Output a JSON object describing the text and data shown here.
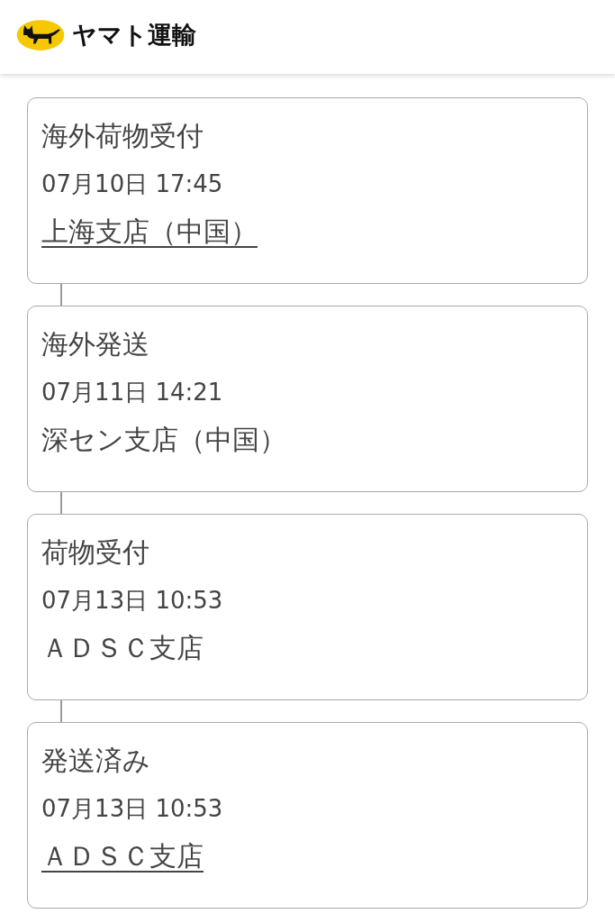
{
  "header": {
    "brand": "ヤマト運輸"
  },
  "events": [
    {
      "status": "海外荷物受付",
      "datetime": "07月10日 17:45",
      "location": "上海支店（中国）",
      "linked": true
    },
    {
      "status": "海外発送",
      "datetime": "07月11日 14:21",
      "location": "深セン支店（中国）",
      "linked": false
    },
    {
      "status": "荷物受付",
      "datetime": "07月13日 10:53",
      "location": "ＡＤＳＣ支店",
      "linked": false
    },
    {
      "status": "発送済み",
      "datetime": "07月13日 10:53",
      "location": "ＡＤＳＣ支店",
      "linked": true
    }
  ]
}
